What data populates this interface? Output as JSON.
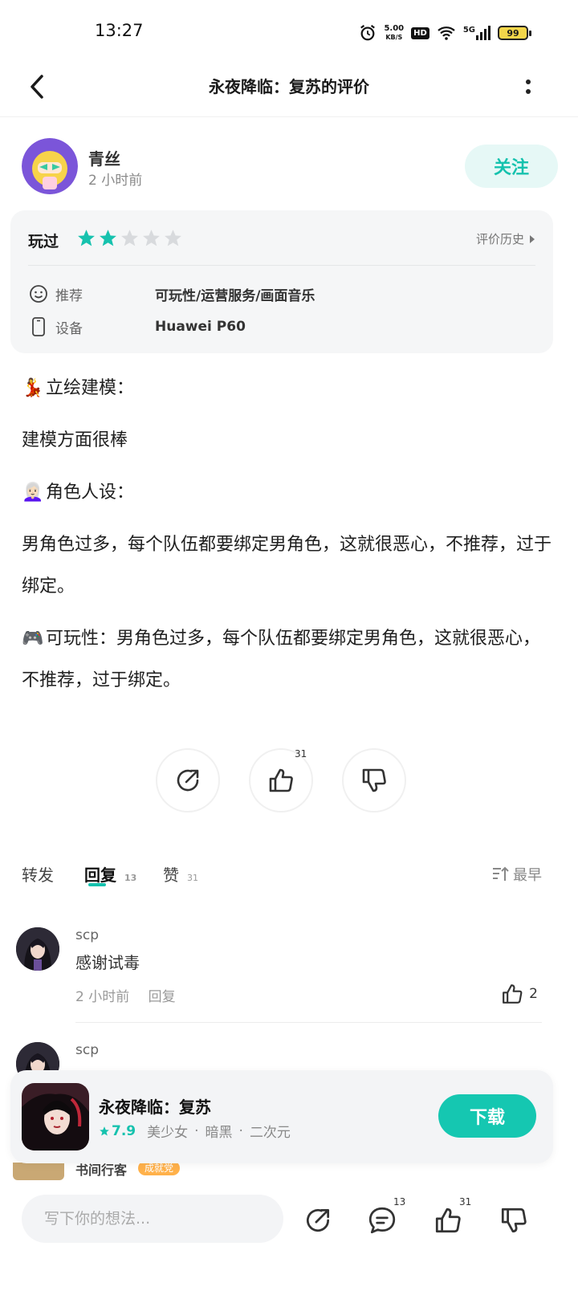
{
  "status_bar": {
    "time": "13:27",
    "speed_value": "5.00",
    "speed_unit": "KB/S",
    "hd": "HD",
    "network": "5G",
    "battery": "99"
  },
  "header": {
    "title": "永夜降临：复苏的评价",
    "back_icon": "chevron-left-icon",
    "more_icon": "more-vertical-icon"
  },
  "author": {
    "name": "青丝",
    "time": "2 小时前",
    "follow_label": "关注"
  },
  "review_card": {
    "played_label": "玩过",
    "rating": 2,
    "max_rating": 5,
    "history_label": "评价历史",
    "recommend_label": "推荐",
    "recommend_value": "可玩性/运营服务/画面音乐",
    "device_label": "设备",
    "device_value": "Huawei P60"
  },
  "review": {
    "p1_emoji": "💃",
    "p1": "立绘建模：",
    "p2": "建模方面很棒",
    "p3_emoji": "👩🏻‍🦳",
    "p3": "角色人设：",
    "p4": "男角色过多，每个队伍都要绑定男角色，这就很恶心，不推荐，过于绑定。",
    "p5_emoji": "🎮",
    "p5": "可玩性：男角色过多，每个队伍都要绑定男角色，这就很恶心，不推荐，过于绑定。"
  },
  "actions": {
    "like_count": "31"
  },
  "tabs": {
    "forward": "转发",
    "reply": "回复",
    "reply_count": "13",
    "like": "赞",
    "like_count": "31",
    "sort": "最早"
  },
  "replies": [
    {
      "name": "scp",
      "text": "感谢试毒",
      "time": "2 小时前",
      "reply_label": "回复",
      "likes": "2"
    },
    {
      "name": "scp"
    }
  ],
  "peek_reply": {
    "name": "书间行客",
    "badge": "成就党"
  },
  "game": {
    "name": "永夜降临：复苏",
    "score": "7.9",
    "tags": [
      "美少女",
      "暗黑",
      "二次元"
    ],
    "download_label": "下载"
  },
  "bottom_bar": {
    "placeholder": "写下你的想法...",
    "comment_count": "13",
    "like_count": "31"
  },
  "colors": {
    "accent": "#16c2ae",
    "star_empty": "#d8dadd"
  }
}
